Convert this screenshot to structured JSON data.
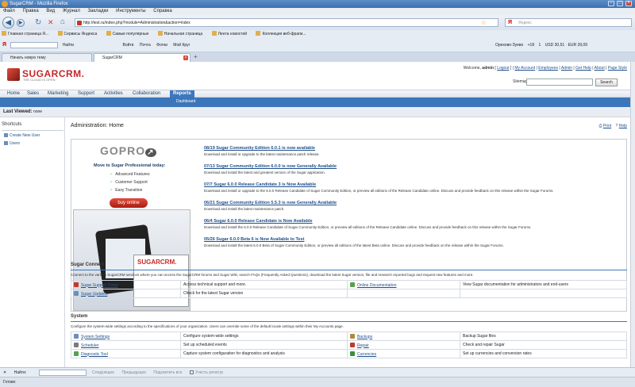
{
  "window": {
    "title": "SugarCRM - Mozilla Firefox"
  },
  "menu": [
    "Файл",
    "Правка",
    "Вид",
    "Журнал",
    "Закладки",
    "Инструменты",
    "Справка"
  ],
  "nav": {
    "url": "http://test.ru/index.php?module=Administration&action=index",
    "search_placeholder": "Яндекс"
  },
  "bookmarks": [
    "Главная страница Я...",
    "Сервисы Яндекса",
    "Самые популярные",
    "Начальная страница",
    "Лента новостей",
    "Коллекция веб-фрагм..."
  ],
  "yandex_bar": {
    "logo": "Я",
    "find": "Найти",
    "items": [
      "Войти",
      "Почта",
      "Фотки",
      "Мой Круг"
    ],
    "weather": "Орехово-Зуево",
    "temp": "+18",
    "notif": "1",
    "rates": "USD 30,51 · EUR 39,09"
  },
  "tabs": [
    {
      "label": "Начать новую тему"
    },
    {
      "label": "SugarCRM"
    }
  ],
  "sugar": {
    "brand": "SUGARCRM.",
    "tagline": "THE CLOUD IS OPEN",
    "welcome": "Welcome,",
    "user": "admin",
    "logout": "Logout",
    "links": [
      "My Account",
      "Employees",
      "Admin",
      "Get Help",
      "About",
      "Page Style"
    ],
    "sitemap": "Sitemap",
    "search_button": "Search",
    "modules": [
      "Home",
      "Sales",
      "Marketing",
      "Support",
      "Activities",
      "Collaboration",
      "Reports"
    ],
    "submodule": "Dashboard",
    "last_viewed_label": "Last Viewed:",
    "last_viewed_value": "none",
    "shortcuts": {
      "title": "Shortcuts",
      "items": [
        "Create New User",
        "Users"
      ]
    },
    "page_title": "Administration: Home",
    "print": "Print",
    "help": "Help",
    "promo": {
      "logo": "GOPRO",
      "headline": "Move to Sugar Professional today:",
      "bullets": [
        "Advanced Features",
        "Customer Support",
        "Easy Transition"
      ],
      "buy": "buy online",
      "shot_brand": "SUGARCRM."
    },
    "news": [
      {
        "title": "08/19 Sugar Community Edition 6.0.1 is now available",
        "desc": "Download and install or upgrade to the latest maintenance patch release."
      },
      {
        "title": "07/13 Sugar Community Edition 6.0.0 is now Generally Available",
        "desc": "Download and install the latest and greatest version of the Sugar application."
      },
      {
        "title": "07/7 Sugar 6.0.0 Release Candidate 3 is Now Available",
        "desc": "Download and install or upgrade to the 6.0.0 Release Candidate of Sugar Community Edition, or preview all editions of the Release Candidate online. Discuss and provide feedback on this release within the Sugar Forums."
      },
      {
        "title": "06/21 Sugar Community Edition 5.5.3 is now Generally Available",
        "desc": "Download and install the latest maintenance patch."
      },
      {
        "title": "06/4 Sugar 6.0.0 Release Candidate is Now Available",
        "desc": "Download and install the 6.0.0 Release Candidate of Sugar Community Edition, or preview all editions of the Release Candidate online. Discuss and provide feedback on this release within the Sugar Forums."
      },
      {
        "title": "05/26 Sugar 6.0.0 Beta 6 is Now Available to Test",
        "desc": "Download and install the latest 6.0.0 Beta of Sugar Community Edition, or preview all editions of the latest Beta online. Discuss and provide feedback on the release within the Sugar Forums."
      }
    ],
    "connect": {
      "title": "Sugar Connect",
      "desc": "Connect to the various SugarCRM services where you can access the SugarCRM forums and Sugar Wiki, search FAQs (Frequently Asked Questions), download the latest Sugar version, file and research reported bugs and request new features and more.",
      "rows": [
        {
          "l1": "Sugar Support Portal",
          "d1": "Access technical support and more.",
          "l2": "Online Documentation",
          "d2": "View Sugar documentation for administrators and end-users"
        },
        {
          "l1": "Sugar Updates",
          "d1": "Check for the latest Sugar version",
          "l2": "",
          "d2": ""
        }
      ]
    },
    "system": {
      "title": "System",
      "desc": "Configure the system-wide settings according to the specifications of your organization. Users can override some of the default locale settings within their My Accounts page.",
      "rows": [
        {
          "l1": "System Settings",
          "d1": "Configure system-wide settings",
          "l2": "Backups",
          "d2": "Backup Sugar files"
        },
        {
          "l1": "Scheduler",
          "d1": "Set up scheduled events",
          "l2": "Repair",
          "d2": "Check and repair Sugar"
        },
        {
          "l1": "Diagnostic Tool",
          "d1": "Capture system configuration for diagnostics and analysis",
          "l2": "Currencies",
          "d2": "Set up currencies and conversion rates"
        }
      ]
    }
  },
  "findbar": {
    "label": "Найти:",
    "next": "Следующее",
    "prev": "Предыдущее",
    "highlight": "Подсветить все",
    "case": "Учесть регистр"
  },
  "status": "Готово",
  "colors": {
    "accent": "#3b76ba",
    "brand": "#c62828",
    "link": "#1f4f8a"
  }
}
